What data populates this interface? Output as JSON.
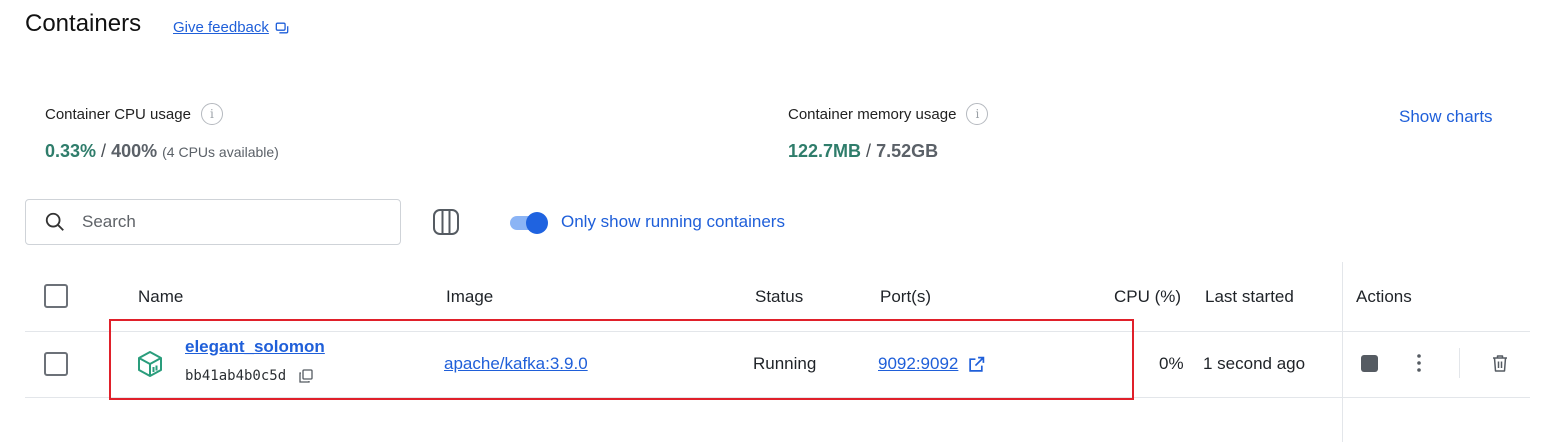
{
  "header": {
    "title": "Containers",
    "feedback_label": "Give feedback"
  },
  "stats": {
    "cpu": {
      "label": "Container CPU usage",
      "used": "0.33%",
      "separator": " / ",
      "max": "400%",
      "note": "(4 CPUs available)"
    },
    "memory": {
      "label": "Container memory usage",
      "used": "122.7MB",
      "separator": " / ",
      "max": "7.52GB"
    },
    "show_charts_label": "Show charts"
  },
  "toolbar": {
    "search_placeholder": "Search",
    "search_value": "",
    "running_toggle_on": true,
    "running_toggle_label": "Only show running containers"
  },
  "table": {
    "columns": [
      "Name",
      "Image",
      "Status",
      "Port(s)",
      "CPU (%)",
      "Last started",
      "Actions"
    ],
    "rows": [
      {
        "name": "elegant_solomon",
        "id": "bb41ab4b0c5d",
        "image": "apache/kafka:3.9.0",
        "status": "Running",
        "ports": "9092:9092",
        "cpu": "0%",
        "last_started": "1 second ago",
        "selected": false
      }
    ]
  },
  "colors": {
    "accent": "#1f5fd9",
    "usage_green": "#2f7d6b",
    "container_icon": "#2a9d7c",
    "highlight_border": "#e0202a"
  },
  "icons": [
    "feedback-icon",
    "info-icon",
    "search-icon",
    "columns-icon",
    "container-icon",
    "copy-icon",
    "external-link-icon",
    "stop-icon",
    "more-vertical-icon",
    "trash-icon"
  ]
}
